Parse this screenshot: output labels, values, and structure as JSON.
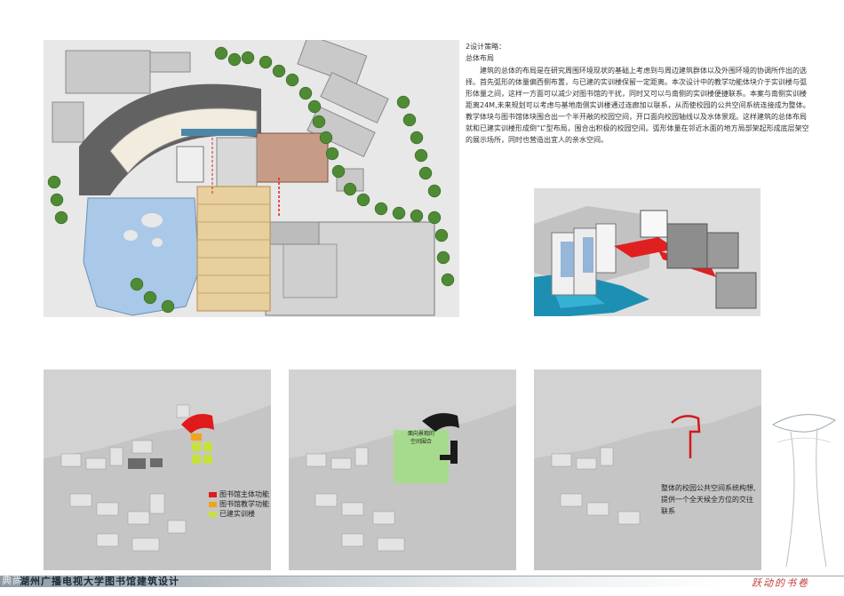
{
  "section": {
    "heading": "2设计策略：",
    "subheading": "总体布局",
    "body": "建筑的总体的布局是在研究周围环境现状的基础上考虑到与周边建筑群体以及外围环境的协调所作出的选择。首先弧形的体量偏西侧布置，与已建的实训楼保留一定距离。本次设计中的教学功能体块介于实训楼与弧形体量之间，这样一方面可以减少对图书馆的干扰，同时又可以与南侧的实训楼便捷联系。本案与南侧实训楼距离24M,未来规划可以考虑与基地南侧实训楼通过连廊加以联系，从而使校园的公共空间系统连接成为整体。教学体块与图书馆体块围合出一个半开敞的校园空间，开口面向校园轴线以及水体景观。这样建筑的总体布局就和已建实训楼形成倒“L”型布局，围合出积极的校园空间。弧形体量在邻近水面的地方局部架起形成底层架空的展示场所，同时也营造出宜人的亲水空间。"
  },
  "legend": [
    {
      "label": "图书馆主体功能",
      "color": "#e01a1a"
    },
    {
      "label": "图书馆教学功能",
      "color": "#f3a21b"
    },
    {
      "label": "已建实训楼",
      "color": "#c6e23a"
    }
  ],
  "map2_tag": "面向景观的空间围合",
  "map3_note": "整体的校园公共空间系统构想,提供一个全天候全方位的交往联系",
  "footer": {
    "left_text": "典尚",
    "title": "湖州广播电视大学图书馆建筑设计",
    "slogan": "跃动的书卷"
  },
  "icons": [
    "tree-icon",
    "scroll-logo-icon"
  ]
}
